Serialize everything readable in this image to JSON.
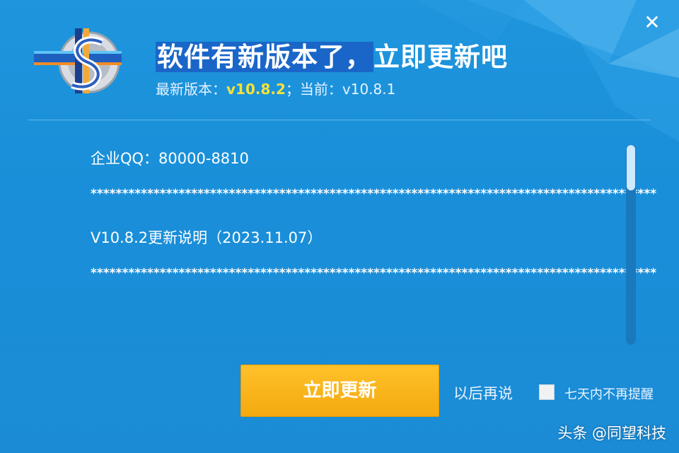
{
  "window": {
    "close_label": "✕"
  },
  "header": {
    "title_part1": "软件有新版本了，",
    "title_part2": "立即更新吧",
    "version_prefix": "最新版本：",
    "latest_version": "v10.8.2",
    "separator": "；",
    "current_prefix": "当前：",
    "current_version": "v10.8.1"
  },
  "content": {
    "lines": [
      "企业QQ：80000-8810",
      "******************************************************************************************",
      "V10.8.2更新说明（2023.11.07）",
      "******************************************************************************************"
    ]
  },
  "actions": {
    "update_label": "立即更新",
    "later_label": "以后再说",
    "no_remind_label": "七天内不再提醒",
    "no_remind_checked": false
  },
  "watermark": {
    "text": "头条 @同望科技"
  },
  "colors": {
    "background": "#1b8fd8",
    "accent_button": "#f7b117",
    "latest_version": "#f5e23a"
  },
  "icons": {
    "close": "close-icon",
    "logo": "app-logo"
  }
}
